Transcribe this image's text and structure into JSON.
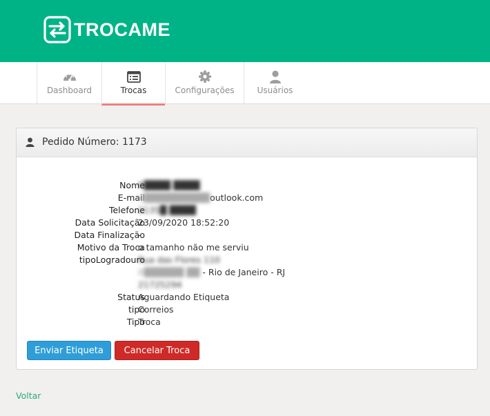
{
  "brand": {
    "name": "TROCAME",
    "color": "#00b386"
  },
  "nav": {
    "items": [
      {
        "label": "Dashboard",
        "icon": "dashboard-icon",
        "active": false
      },
      {
        "label": "Trocas",
        "icon": "list-icon",
        "active": true
      },
      {
        "label": "Configurações",
        "icon": "gear-icon",
        "active": false
      },
      {
        "label": "Usuários",
        "icon": "user-icon",
        "active": false
      }
    ]
  },
  "panel": {
    "title": "Pedido Número: 1173",
    "fields": [
      {
        "label": "Nome",
        "value": "R████ ████"
      },
      {
        "label": "E-mail",
        "value": "b██████████outlook.com"
      },
      {
        "label": "Telefone",
        "value": "2135█ ████"
      },
      {
        "label": "Data Solicitação",
        "value": "23/09/2020 18:52:20"
      },
      {
        "label": "Data Finalização",
        "value": "-"
      },
      {
        "label": "Motivo da Troca",
        "value": "o tamanho não me serviu"
      },
      {
        "label": "tipoLogradouro",
        "value": "Rua das Flores 110"
      },
      {
        "label": "",
        "value": "B██████ ██ - Rio de Janeiro - RJ"
      },
      {
        "label": "",
        "value": "21725294"
      },
      {
        "label": "Status",
        "value": "Aguardando Etiqueta"
      },
      {
        "label": "tipo",
        "value": "Correios"
      },
      {
        "label": "Tipo",
        "value": "Troca"
      }
    ],
    "buttons": {
      "send": "Enviar Etiqueta",
      "cancel": "Cancelar Troca"
    }
  },
  "footer": {
    "back_link": "Voltar"
  },
  "colors": {
    "accent": "#00b386",
    "active_tab_underline": "#ef7f7c",
    "primary_button": "#2f9ed8",
    "danger_button": "#cf2a27",
    "link": "#2aa87e"
  }
}
